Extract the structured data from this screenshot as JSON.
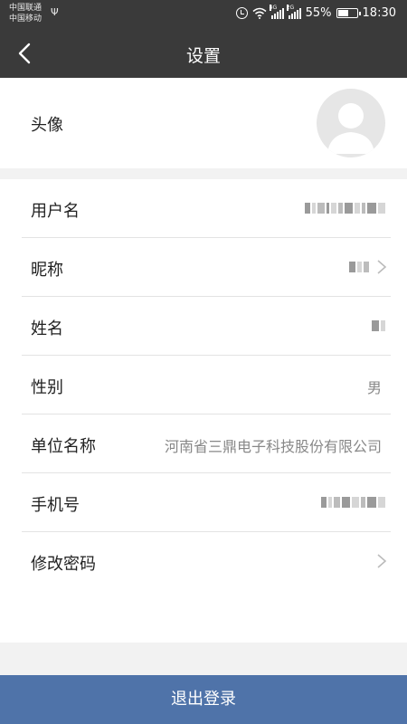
{
  "status_bar": {
    "carrier_1": "中国联通",
    "carrier_2": "中国移动",
    "net_1": "4G",
    "net_2": "2G",
    "battery": "55%",
    "battery_level": 0.55,
    "time": "18:30",
    "icons": [
      "usb-icon",
      "alarm-icon",
      "wifi-icon",
      "signal-icon",
      "battery-icon"
    ]
  },
  "header": {
    "title": "设置",
    "back_icon": "chevron-left-icon"
  },
  "avatar_row": {
    "label": "头像",
    "icon": "default-avatar-icon"
  },
  "rows": [
    {
      "label": "用户名",
      "value": "",
      "redacted": true,
      "arrow": false
    },
    {
      "label": "昵称",
      "value": "",
      "redacted": true,
      "arrow": true
    },
    {
      "label": "姓名",
      "value": "",
      "redacted": true,
      "arrow": false
    },
    {
      "label": "性别",
      "value": "男",
      "redacted": false,
      "arrow": false
    },
    {
      "label": "单位名称",
      "value": "河南省三鼎电子科技股份有限公司",
      "redacted": false,
      "arrow": false
    },
    {
      "label": "手机号",
      "value": "",
      "redacted": true,
      "arrow": false
    },
    {
      "label": "修改密码",
      "value": "",
      "redacted": false,
      "arrow": true
    }
  ],
  "logout_button": {
    "label": "退出登录"
  },
  "colors": {
    "header_bg": "#3a3a3a",
    "logout_bg": "#4f73a9",
    "page_bg": "#f2f2f2"
  }
}
